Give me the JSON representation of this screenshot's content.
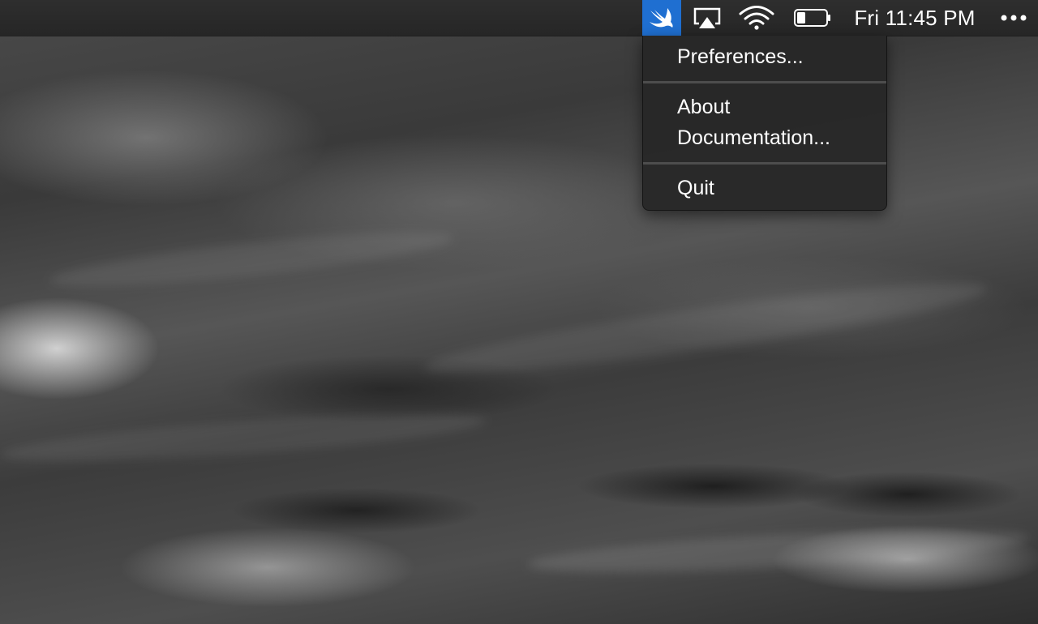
{
  "menubar": {
    "status_items": [
      {
        "name": "swift-icon",
        "active": true
      },
      {
        "name": "airplay-icon"
      },
      {
        "name": "wifi-icon"
      },
      {
        "name": "battery-icon"
      }
    ],
    "clock": "Fri 11:45 PM",
    "overflow_icon": "ellipsis-icon"
  },
  "menu": {
    "items": [
      {
        "label": "Preferences..."
      },
      {
        "label": "About"
      },
      {
        "label": "Documentation..."
      },
      {
        "label": "Quit"
      }
    ]
  },
  "colors": {
    "menubar_bg": "#2a2a2a",
    "active_item_bg": "#1f6fd1",
    "menu_bg": "#282828",
    "separator": "#4d4d4d",
    "text": "#ffffff"
  }
}
